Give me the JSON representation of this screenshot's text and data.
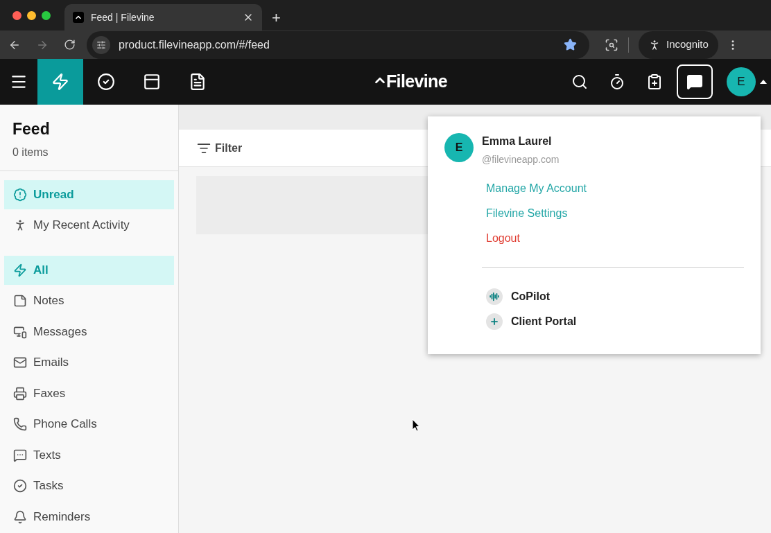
{
  "browser": {
    "tab_title": "Feed | Filevine",
    "new_tab": "+",
    "address": "product.filevineapp.com/#/feed",
    "profile": "Incognito"
  },
  "app_header": {
    "logo": "Filevine",
    "nav": [
      {
        "selected": true
      },
      {
        "selected": false
      },
      {
        "selected": false
      },
      {
        "selected": false
      }
    ],
    "avatar": "E"
  },
  "sidebar": {
    "title": "Feed",
    "count": "0 items",
    "groups": [
      [
        {
          "label": "Unread",
          "selected": true
        },
        {
          "label": "My Recent Activity",
          "selected": false
        }
      ],
      [
        {
          "label": "All",
          "selected": true
        },
        {
          "label": "Notes",
          "selected": false
        },
        {
          "label": "Messages",
          "selected": false
        },
        {
          "label": "Emails",
          "selected": false
        },
        {
          "label": "Faxes",
          "selected": false
        },
        {
          "label": "Phone Calls",
          "selected": false
        },
        {
          "label": "Texts",
          "selected": false
        },
        {
          "label": "Tasks",
          "selected": false
        },
        {
          "label": "Reminders",
          "selected": false
        }
      ]
    ]
  },
  "toolbar": {
    "filter": "Filter"
  },
  "account_menu": {
    "avatar": "E",
    "name": "Emma Laurel",
    "email": "@filevineapp.com",
    "links": [
      {
        "label": "Manage My Account",
        "kind": "link"
      },
      {
        "label": "Filevine Settings",
        "kind": "link"
      },
      {
        "label": "Logout",
        "kind": "danger"
      }
    ],
    "apps": [
      {
        "label": "CoPilot"
      },
      {
        "label": "Client Portal"
      }
    ]
  }
}
